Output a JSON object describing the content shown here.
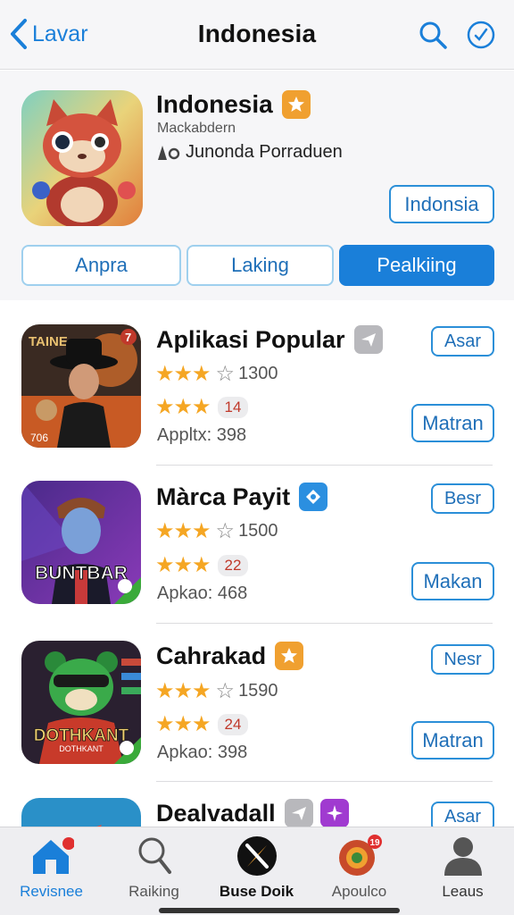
{
  "nav": {
    "back_label": "Lavar",
    "title": "Indonesia"
  },
  "featured": {
    "title": "Indonesia",
    "subtitle": "Mackabdern",
    "developer": "Junonda Porraduen",
    "action_label": "Indonsia",
    "segments": [
      "Anpra",
      "Laking",
      "Pealkiing"
    ],
    "active_segment": 2
  },
  "apps": [
    {
      "name": "Aplikasi Popular",
      "rating": 3,
      "rating_count": "1300",
      "pill": "14",
      "meta": "Appltx: 398",
      "action_top": "Asar",
      "action_bottom": "Matran",
      "icon_text": "TAINE",
      "icon_corner": "7",
      "icon_bottom": "706"
    },
    {
      "name": "Màrca Payit",
      "rating": 3,
      "rating_count": "1500",
      "pill": "22",
      "meta": "Apkao: 468",
      "action_top": "Besr",
      "action_bottom": "Makan",
      "icon_text": "BUNTBAR"
    },
    {
      "name": "Cahrakad",
      "rating": 3,
      "rating_count": "1590",
      "pill": "24",
      "meta": "Apkao: 398",
      "action_top": "Nesr",
      "action_bottom": "Matran",
      "icon_text": "DOTHKANT",
      "icon_subtext": "DOTHKANT"
    },
    {
      "name": "Dealvadall",
      "action_top": "Asar"
    }
  ],
  "tabs": [
    {
      "label": "Revisnee",
      "icon": "home-icon",
      "badge": ""
    },
    {
      "label": "Raiking",
      "icon": "search-icon",
      "badge": ""
    },
    {
      "label": "Buse Doik",
      "icon": "compass-icon",
      "badge": ""
    },
    {
      "label": "Apoulco",
      "icon": "apps-icon",
      "badge": "19"
    },
    {
      "label": "Leaus",
      "icon": "person-icon",
      "badge": ""
    }
  ],
  "colors": {
    "accent": "#1a7fd9",
    "star": "#f5a623",
    "badge_orange": "#f0a030"
  }
}
